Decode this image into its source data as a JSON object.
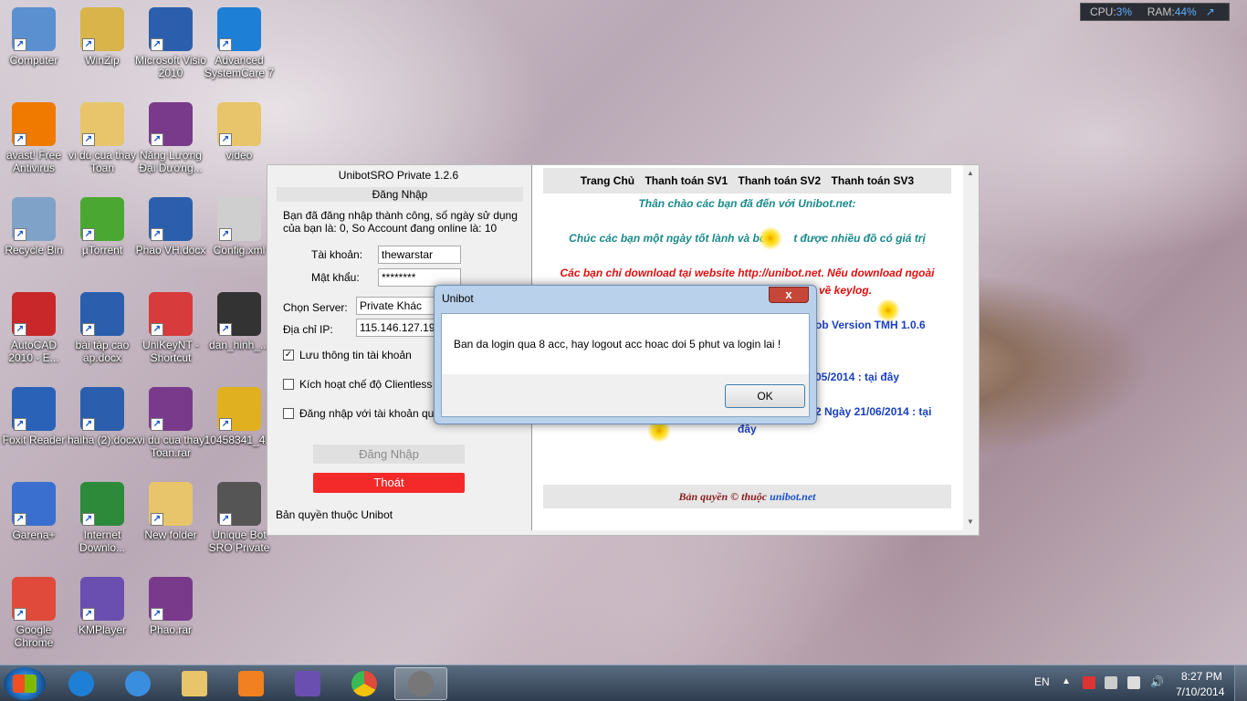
{
  "desktop_icons": [
    {
      "label": "Computer",
      "icon": "computer-icon",
      "color": "#5a8fd0"
    },
    {
      "label": "WinZip",
      "icon": "winzip-icon",
      "color": "#d9b44a"
    },
    {
      "label": "Microsoft Visio 2010",
      "icon": "visio-icon",
      "color": "#2b5fad"
    },
    {
      "label": "Advanced SystemCare 7",
      "icon": "systemcare-icon",
      "color": "#1e7fd6"
    },
    {
      "label": "avast! Free Antivirus",
      "icon": "avast-icon",
      "color": "#f07a00"
    },
    {
      "label": "vi du cua thay Toan",
      "icon": "folder-icon",
      "color": "#e8c56a"
    },
    {
      "label": "Năng Lượng Đại Dương...",
      "icon": "winrar-icon",
      "color": "#7a3a8c"
    },
    {
      "label": "video",
      "icon": "folder-icon",
      "color": "#e8c56a"
    },
    {
      "label": "Recycle Bin",
      "icon": "recycle-bin-icon",
      "color": "#7fa3c8"
    },
    {
      "label": "µTorrent",
      "icon": "utorrent-icon",
      "color": "#4aa832"
    },
    {
      "label": "Phao VH.docx",
      "icon": "word-doc-icon",
      "color": "#2b5fad"
    },
    {
      "label": "Config.xml",
      "icon": "xml-file-icon",
      "color": "#cfcfcf"
    },
    {
      "label": "AutoCAD 2010 - E...",
      "icon": "autocad-icon",
      "color": "#c8282a"
    },
    {
      "label": "bài tập cao áp.docx",
      "icon": "word-doc-icon",
      "color": "#2b5fad"
    },
    {
      "label": "UniKeyNT - Shortcut",
      "icon": "unikey-icon",
      "color": "#d83b3b"
    },
    {
      "label": "dan_hinh_...",
      "icon": "image-file-icon",
      "color": "#333333"
    },
    {
      "label": "Foxit Reader",
      "icon": "foxit-icon",
      "color": "#2a62b8"
    },
    {
      "label": "haiha (2).docx",
      "icon": "word-doc-icon",
      "color": "#2b5fad"
    },
    {
      "label": "vi du cua thay Toan.rar",
      "icon": "winrar-icon",
      "color": "#7a3a8c"
    },
    {
      "label": "10458341_4...",
      "icon": "image-file-icon",
      "color": "#e0b020"
    },
    {
      "label": "Garena+",
      "icon": "garena-icon",
      "color": "#3a6fd0"
    },
    {
      "label": "Internet Downlo...",
      "icon": "idm-icon",
      "color": "#2d8a3a"
    },
    {
      "label": "New folder",
      "icon": "folder-icon",
      "color": "#e8c56a"
    },
    {
      "label": "Unique Bot SRO Private",
      "icon": "unibot-icon",
      "color": "#555555"
    },
    {
      "label": "Google Chrome",
      "icon": "chrome-icon",
      "color": "#e04a3a"
    },
    {
      "label": "KMPlayer",
      "icon": "kmplayer-icon",
      "color": "#6a4fb0"
    },
    {
      "label": "Phao.rar",
      "icon": "winrar-icon",
      "color": "#7a3a8c"
    }
  ],
  "cpu_widget": {
    "cpu_label": "CPU:",
    "cpu_value": "3%",
    "ram_label": "RAM:",
    "ram_value": "44%",
    "arrow": "↗"
  },
  "main_window": {
    "title": "UnibotSRO Private 1.2.6",
    "section": "Đăng Nhập",
    "info": "Bạn đã đăng nhập thành công, số ngày sử dụng của bạn là: 0, So Account đang online là: 10",
    "account_label": "Tài khoản:",
    "account_value": "thewarstar",
    "password_label": "Mật khẩu:",
    "password_value": "********",
    "server_label": "Chọn Server:",
    "server_value": "Private Khác",
    "ip_label": "Địa chỉ IP:",
    "ip_value": "115.146.127.19",
    "save_info": "Lưu thông tin tài khoản",
    "clientless": "Kích hoạt chế độ Clientless",
    "login_other": "Đăng nhập với tài khoản qu",
    "login_button": "Đăng Nhập",
    "exit_button": "Thoát",
    "copyright": "Bản quyền thuộc Unibot"
  },
  "web": {
    "nav": [
      "Trang Chủ",
      "Thanh toán SV1",
      "Thanh toán SV2",
      "Thanh toán SV3"
    ],
    "welcome": "Thân chào các bạn đã đến với Unibot.net:",
    "wish": "Chúc các bạn một ngày tốt lành và bot",
    "wish_tail": "t được nhiều đồ có giá trị",
    "warn1": "Các bạn chỉ download tại website http://unibot.net. Nếu download ngoài",
    "warn2": "m về keylog.",
    "job": "ob Version TMH 1.0.6",
    "date1_a": "05/2014 : ",
    "date1_link": "tại đây",
    "date2_a": "2 Ngày 21/06/2014 : ",
    "date2_link": "tại",
    "date2_b": "đây",
    "footer": "Bản quyền © thuộc",
    "footer_link": "unibot.net",
    "colors": {
      "teal": "#1a8a8a",
      "red": "#e01010",
      "blue": "#1a3fc0"
    }
  },
  "dialog": {
    "title": "Unibot",
    "close": "x",
    "message": "Ban da login qua 8 acc, hay logout acc hoac doi 5 phut va login lai !",
    "ok": "OK"
  },
  "taskbar": {
    "pinned": [
      "start-button",
      "systemcare-icon",
      "internet-explorer-icon",
      "windows-explorer-icon",
      "media-player-icon",
      "visio-icon",
      "chrome-icon",
      "unibot-icon"
    ],
    "lang": "EN",
    "time": "8:27 PM",
    "date": "7/10/2014"
  }
}
